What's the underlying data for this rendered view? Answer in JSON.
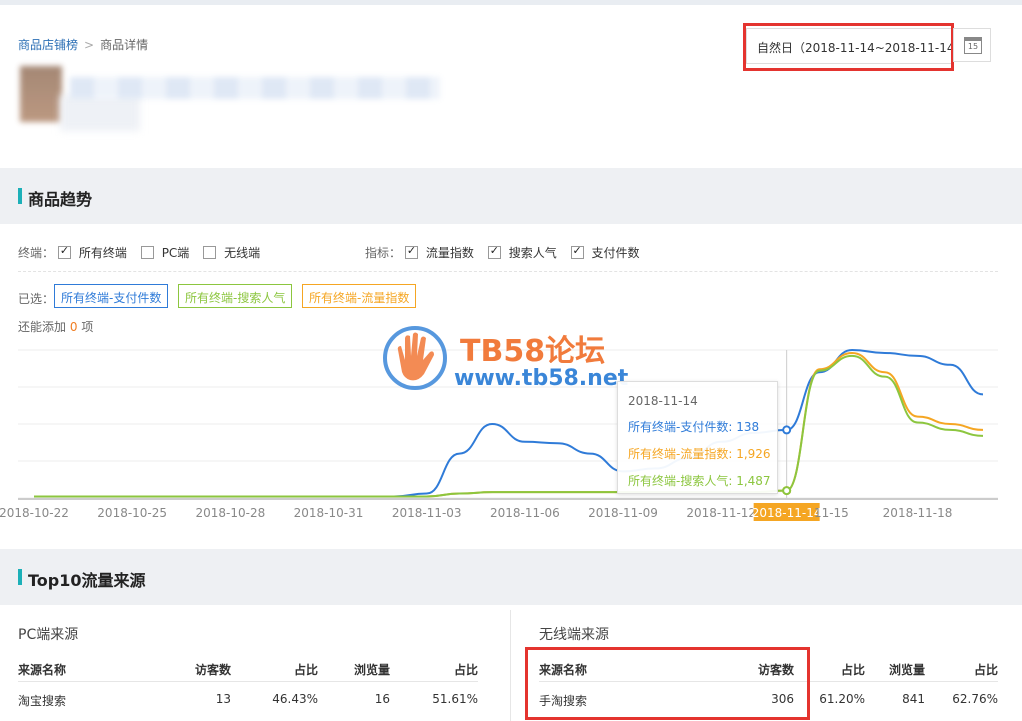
{
  "breadcrumb": {
    "parent": "商品店铺榜",
    "sep": ">",
    "current": "商品详情"
  },
  "date_range": {
    "value": "自然日（2018-11-14~2018-11-14）",
    "calendar_day": "15"
  },
  "trend": {
    "title": "商品趋势",
    "terminal_label": "终端：",
    "terminals": [
      {
        "label": "所有终端",
        "checked": true
      },
      {
        "label": "PC端",
        "checked": false
      },
      {
        "label": "无线端",
        "checked": false
      }
    ],
    "metric_label": "指标：",
    "metrics": [
      {
        "label": "流量指数",
        "checked": true
      },
      {
        "label": "搜索人气",
        "checked": true
      },
      {
        "label": "支付件数",
        "checked": true
      }
    ],
    "selected_label": "已选：",
    "tags": [
      {
        "label": "所有终端-支付件数",
        "color": "#2f7bd8"
      },
      {
        "label": "所有终端-搜索人气",
        "color": "#8cc63f"
      },
      {
        "label": "所有终端-流量指数",
        "color": "#f5a623"
      }
    ],
    "add_more_prefix": "还能添加",
    "add_more_count": "0",
    "add_more_suffix": "项"
  },
  "watermark": {
    "title": "TB58论坛",
    "url": "www.tb58.net"
  },
  "chart_data": {
    "type": "line",
    "x": [
      "2018-10-22",
      "2018-10-23",
      "2018-10-24",
      "2018-10-25",
      "2018-10-26",
      "2018-10-27",
      "2018-10-28",
      "2018-10-29",
      "2018-10-30",
      "2018-10-31",
      "2018-11-01",
      "2018-11-02",
      "2018-11-03",
      "2018-11-04",
      "2018-11-05",
      "2018-11-06",
      "2018-11-07",
      "2018-11-08",
      "2018-11-09",
      "2018-11-10",
      "2018-11-11",
      "2018-11-12",
      "2018-11-13",
      "2018-11-14",
      "2018-11-15",
      "2018-11-16",
      "2018-11-17",
      "2018-11-18",
      "2018-11-19",
      "2018-11-20"
    ],
    "tick_labels": [
      "2018-10-22",
      "2018-10-25",
      "2018-10-28",
      "2018-10-31",
      "2018-11-03",
      "2018-11-06",
      "2018-11-09",
      "2018-11-12",
      "2018-11-14",
      "11-15",
      "2018-11-18"
    ],
    "highlight_x": "2018-11-14",
    "ylim": [
      0,
      1
    ],
    "grid": true,
    "series": [
      {
        "name": "所有终端-支付件数",
        "color": "#2f7bd8",
        "values": [
          0.01,
          0.01,
          0.01,
          0.01,
          0.01,
          0.01,
          0.01,
          0.01,
          0.01,
          0.01,
          0.01,
          0.01,
          0.03,
          0.3,
          0.5,
          0.38,
          0.37,
          0.3,
          0.18,
          0.2,
          0.27,
          0.38,
          0.44,
          0.46,
          0.85,
          1.0,
          0.98,
          0.96,
          0.9,
          0.7
        ]
      },
      {
        "name": "所有终端-流量指数",
        "color": "#f5a623",
        "values": [
          0.01,
          0.01,
          0.01,
          0.01,
          0.01,
          0.01,
          0.01,
          0.01,
          0.01,
          0.01,
          0.01,
          0.01,
          0.01,
          0.03,
          0.04,
          0.04,
          0.04,
          0.04,
          0.04,
          0.04,
          0.04,
          0.04,
          0.04,
          0.05,
          0.87,
          0.98,
          0.85,
          0.55,
          0.5,
          0.46
        ]
      },
      {
        "name": "所有终端-搜索人气",
        "color": "#8cc63f",
        "values": [
          0.01,
          0.01,
          0.01,
          0.01,
          0.01,
          0.01,
          0.01,
          0.01,
          0.01,
          0.01,
          0.01,
          0.01,
          0.01,
          0.03,
          0.04,
          0.04,
          0.04,
          0.04,
          0.04,
          0.04,
          0.04,
          0.04,
          0.04,
          0.05,
          0.86,
          0.96,
          0.82,
          0.51,
          0.46,
          0.42
        ]
      }
    ],
    "tooltip": {
      "date": "2018-11-14",
      "items": [
        {
          "label": "所有终端-支付件数: 138",
          "color": "#2f7bd8"
        },
        {
          "label": "所有终端-流量指数: 1,926",
          "color": "#f5a623"
        },
        {
          "label": "所有终端-搜索人气: 1,487",
          "color": "#8cc63f"
        }
      ]
    }
  },
  "top10": {
    "title": "Top10流量来源",
    "pc": {
      "title": "PC端来源",
      "headers": [
        "来源名称",
        "访客数",
        "占比",
        "浏览量",
        "占比"
      ],
      "rows": [
        [
          "淘宝搜索",
          "13",
          "46.43%",
          "16",
          "51.61%"
        ]
      ]
    },
    "mobile": {
      "title": "无线端来源",
      "headers": [
        "来源名称",
        "访客数",
        "占比",
        "浏览量",
        "占比"
      ],
      "rows": [
        [
          "手淘搜索",
          "306",
          "61.20%",
          "841",
          "62.76%"
        ]
      ]
    }
  }
}
